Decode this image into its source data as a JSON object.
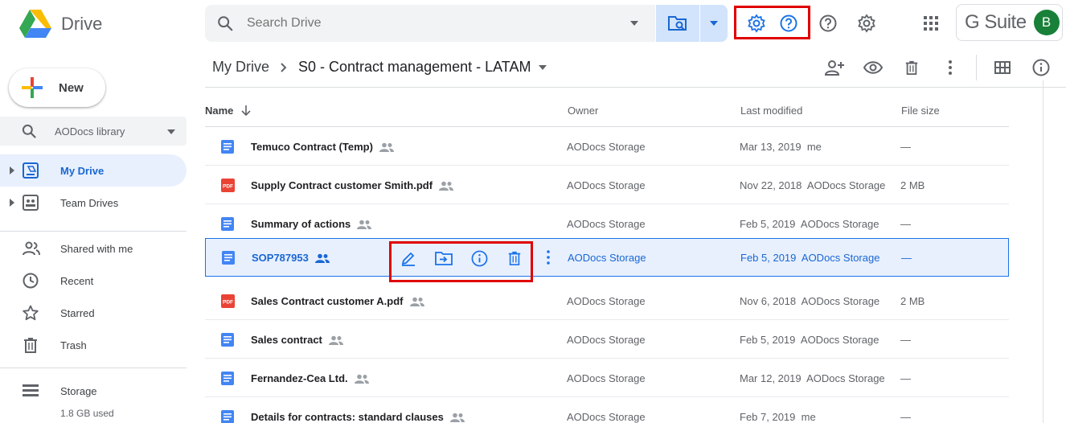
{
  "app": {
    "name": "Drive"
  },
  "search": {
    "placeholder": "Search Drive"
  },
  "account": {
    "brand": "G Suite",
    "avatar_initial": "B"
  },
  "sidebar": {
    "new_label": "New",
    "library_label": "AODocs library",
    "items": [
      {
        "label": "My Drive",
        "icon": "my-drive-icon",
        "active": true
      },
      {
        "label": "Team Drives",
        "icon": "team-drives-icon"
      },
      {
        "label": "Shared with me",
        "icon": "people-icon"
      },
      {
        "label": "Recent",
        "icon": "clock-icon"
      },
      {
        "label": "Starred",
        "icon": "star-icon"
      },
      {
        "label": "Trash",
        "icon": "trash-icon"
      },
      {
        "label": "Storage",
        "icon": "storage-icon"
      }
    ],
    "storage_used": "1.8 GB used"
  },
  "breadcrumb": {
    "root": "My Drive",
    "current": "S0 - Contract management - LATAM"
  },
  "table": {
    "headers": {
      "name": "Name",
      "owner": "Owner",
      "modified": "Last modified",
      "size": "File size"
    },
    "rows": [
      {
        "type": "doc",
        "name": "Temuco Contract (Temp)",
        "owner": "AODocs Storage",
        "modified": "Mar 13, 2019  me",
        "size": "—"
      },
      {
        "type": "pdf",
        "name": "Supply Contract customer Smith.pdf",
        "owner": "AODocs Storage",
        "modified": "Nov 22, 2018  AODocs Storage",
        "size": "2 MB"
      },
      {
        "type": "doc",
        "name": "Summary of actions",
        "owner": "AODocs Storage",
        "modified": "Feb 5, 2019  AODocs Storage",
        "size": "—"
      },
      {
        "type": "doc",
        "name": "SOP787953",
        "owner": "AODocs Storage",
        "modified": "Feb 5, 2019  AODocs Storage",
        "size": "—",
        "selected": true
      },
      {
        "type": "pdf",
        "name": "Sales Contract customer A.pdf",
        "owner": "AODocs Storage",
        "modified": "Nov 6, 2018  AODocs Storage",
        "size": "2 MB"
      },
      {
        "type": "doc",
        "name": "Sales contract",
        "owner": "AODocs Storage",
        "modified": "Feb 5, 2019  AODocs Storage",
        "size": "—"
      },
      {
        "type": "doc",
        "name": "Fernandez-Cea Ltd.",
        "owner": "AODocs Storage",
        "modified": "Mar 12, 2019  AODocs Storage",
        "size": "—"
      },
      {
        "type": "doc",
        "name": "Details for contracts: standard clauses",
        "owner": "AODocs Storage",
        "modified": "Feb 7, 2019  me",
        "size": "—"
      }
    ]
  },
  "pdf_badge": "PDF",
  "colors": {
    "accent": "#1a73e8",
    "highlight": "#e00000",
    "selected_bg": "#e8f0fe"
  }
}
